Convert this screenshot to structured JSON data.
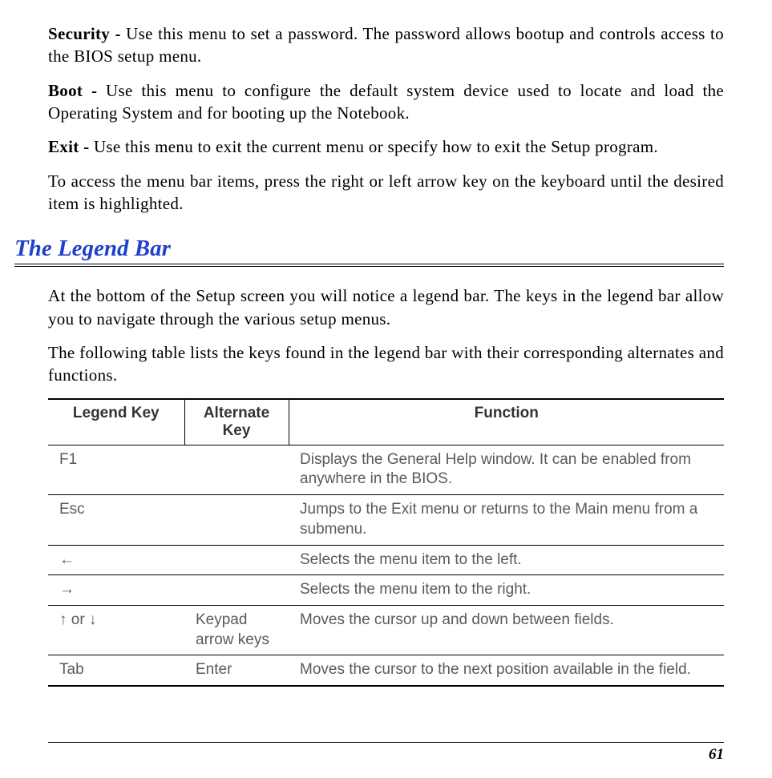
{
  "paragraphs": {
    "security": {
      "label": "Security - ",
      "text": "Use this menu to set a password.  The password allows bootup and controls access to the BIOS setup menu."
    },
    "boot": {
      "label": "Boot - ",
      "text": "Use this menu to configure the default system device used to locate and load the Operating System and for booting up the Notebook."
    },
    "exit": {
      "label": "Exit - ",
      "text": "Use this menu to exit the current menu or specify how to exit the Setup program."
    },
    "access": "To access the menu bar items, press the right or left arrow key on the keyboard until the desired item is highlighted."
  },
  "heading": "The Legend Bar",
  "intro1": "At the bottom of the Setup screen you will notice a legend bar.  The keys in the legend bar allow you to navigate through the various setup menus.",
  "intro2": "The following table lists the keys found in the legend bar with their corresponding alternates and functions.",
  "table": {
    "headers": {
      "legend": "Legend Key",
      "alternate": "Alternate Key",
      "function": "Function"
    },
    "rows": [
      {
        "legend": "F1",
        "alternate": "",
        "function": "Displays the General Help window.  It can be enabled from anywhere in the BIOS."
      },
      {
        "legend": "Esc",
        "alternate": "",
        "function": "Jumps to the Exit menu or returns to the Main menu from a submenu."
      },
      {
        "legend": "←",
        "alternate": "",
        "function": "Selects the menu item to the left."
      },
      {
        "legend": "→",
        "alternate": "",
        "function": "Selects the menu item to the right."
      },
      {
        "legend": "↑ or ↓",
        "alternate": "Keypad arrow keys",
        "function": "Moves the cursor up and down between fields."
      },
      {
        "legend": "Tab",
        "alternate": "Enter",
        "function": "Moves the cursor to the next position available in the field."
      }
    ]
  },
  "pageNumber": "61"
}
